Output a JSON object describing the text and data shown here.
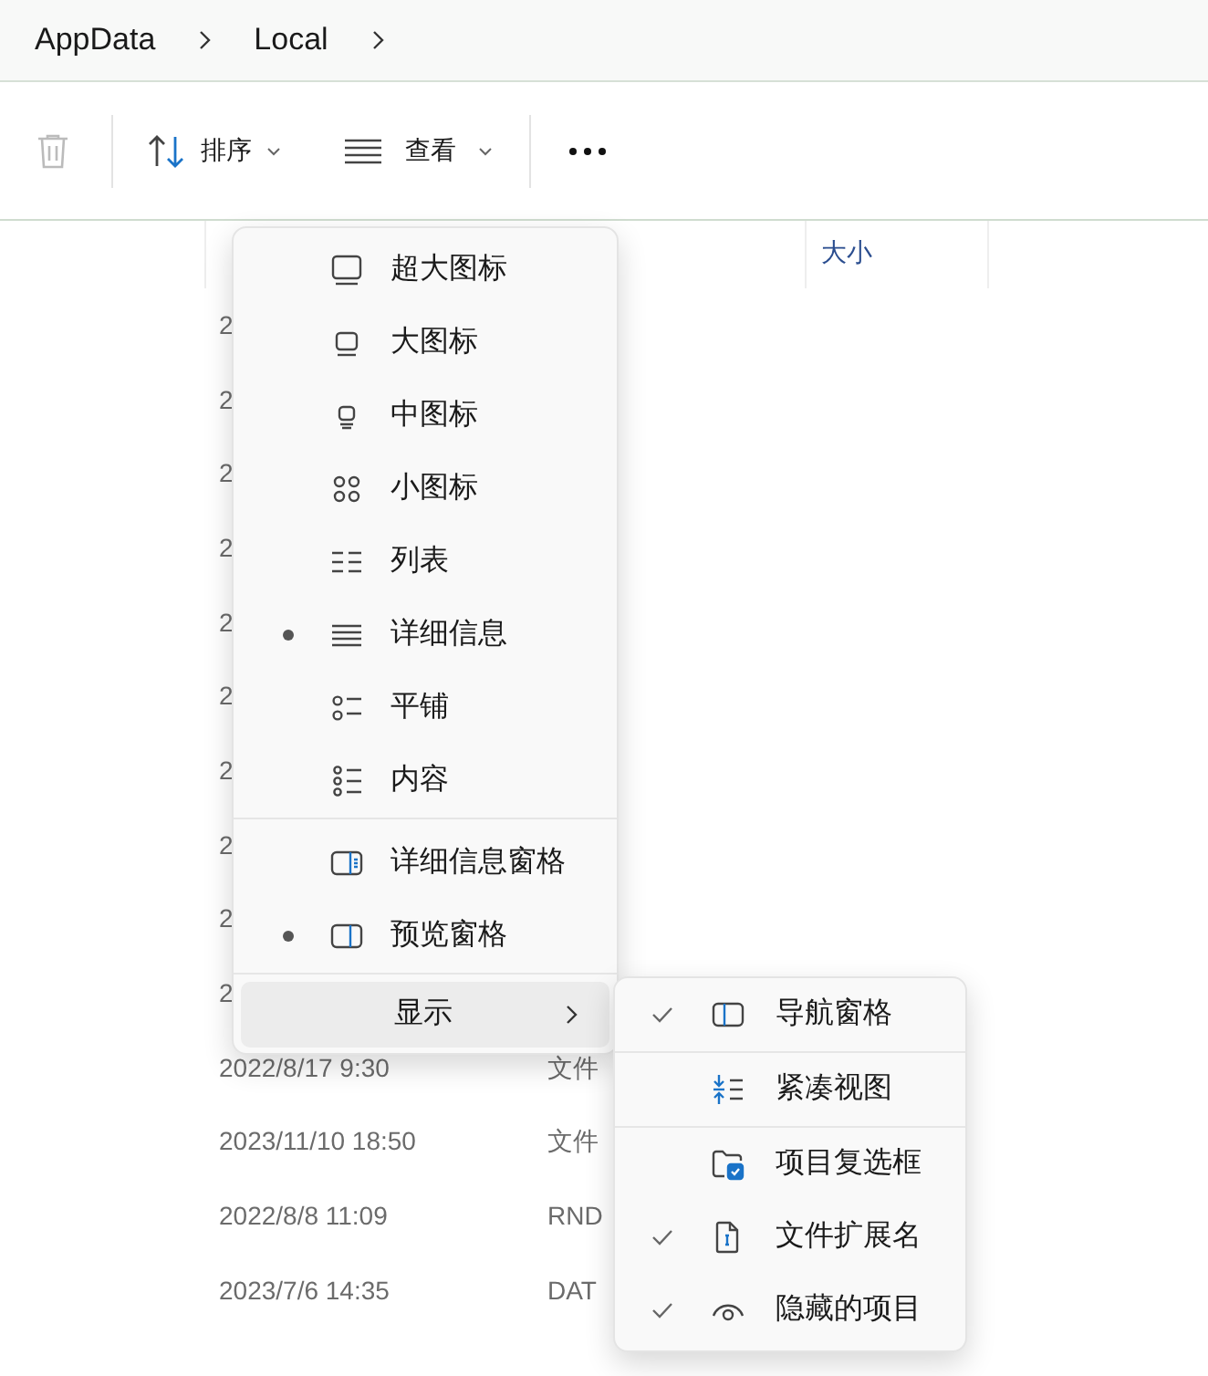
{
  "breadcrumb": [
    "AppData",
    "Local"
  ],
  "toolbar": {
    "delete_disabled": true,
    "sort": "排序",
    "view": "查看"
  },
  "table": {
    "columns": [
      "大小"
    ],
    "rows": [
      {
        "date": "2"
      },
      {
        "date": "2"
      },
      {
        "date": "2"
      },
      {
        "date": "2"
      },
      {
        "date": "2"
      },
      {
        "date": "2"
      },
      {
        "date": "2"
      },
      {
        "date": "2"
      },
      {
        "date": "2"
      },
      {
        "date": "2"
      },
      {
        "date": "2022/8/17 9:30",
        "type": "文件"
      },
      {
        "date": "2023/11/10 18:50",
        "type": "文件"
      },
      {
        "date": "2022/8/8 11:09",
        "type": "RND"
      },
      {
        "date": "2023/7/6 14:35",
        "type": "DAT"
      }
    ]
  },
  "view_menu": {
    "groups": [
      [
        {
          "kind": "xl",
          "label": "超大图标",
          "selected": false
        },
        {
          "kind": "large",
          "label": "大图标",
          "selected": false
        },
        {
          "kind": "medium",
          "label": "中图标",
          "selected": false
        },
        {
          "kind": "small",
          "label": "小图标",
          "selected": false
        },
        {
          "kind": "list",
          "label": "列表",
          "selected": false
        },
        {
          "kind": "details",
          "label": "详细信息",
          "selected": true
        },
        {
          "kind": "tiles",
          "label": "平铺",
          "selected": false
        },
        {
          "kind": "content",
          "label": "内容",
          "selected": false
        }
      ],
      [
        {
          "kind": "details_pane",
          "label": "详细信息窗格",
          "selected": false
        },
        {
          "kind": "preview_pane",
          "label": "预览窗格",
          "selected": true
        }
      ],
      [
        {
          "kind": "submenu",
          "label": "显示",
          "selected": true
        }
      ]
    ]
  },
  "show_submenu": {
    "groups": [
      [
        {
          "kind": "nav_pane",
          "label": "导航窗格",
          "checked": true
        }
      ],
      [
        {
          "kind": "compact",
          "label": "紧凑视图",
          "checked": false
        }
      ],
      [
        {
          "kind": "checkboxes",
          "label": "项目复选框",
          "checked": false
        },
        {
          "kind": "extensions",
          "label": "文件扩展名",
          "checked": true
        },
        {
          "kind": "hidden",
          "label": "隐藏的项目",
          "checked": true
        }
      ]
    ]
  }
}
